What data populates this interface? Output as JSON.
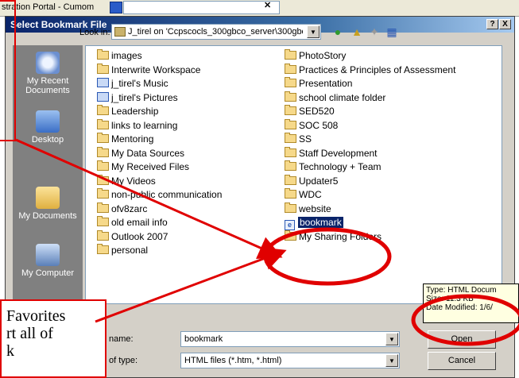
{
  "background_window": {
    "title_fragment": "stration Portal - Cumom"
  },
  "dialog": {
    "title": "Select Bookmark File",
    "help_button": "?",
    "close_button": "X",
    "look_in_label": "Look in:",
    "look_in_value": "J_tirel on 'Ccpscocls_300gbco_server\\300gbc",
    "places": [
      "My Recent Documents",
      "Desktop",
      "My Documents",
      "My Computer"
    ],
    "files_left": [
      {
        "name": "images",
        "type": "folder"
      },
      {
        "name": "Interwrite Workspace",
        "type": "folder"
      },
      {
        "name": "j_tirel's Music",
        "type": "folder-special"
      },
      {
        "name": "j_tirel's Pictures",
        "type": "folder-special"
      },
      {
        "name": "Leadership",
        "type": "folder"
      },
      {
        "name": "links to learning",
        "type": "folder"
      },
      {
        "name": "Mentoring",
        "type": "folder"
      },
      {
        "name": "My Data Sources",
        "type": "folder"
      },
      {
        "name": "My Received Files",
        "type": "folder"
      },
      {
        "name": "My Videos",
        "type": "folder"
      },
      {
        "name": "non-public communication",
        "type": "folder"
      },
      {
        "name": "ofv8zarc",
        "type": "folder"
      },
      {
        "name": "old email info",
        "type": "folder"
      },
      {
        "name": "Outlook 2007",
        "type": "folder"
      },
      {
        "name": "personal",
        "type": "folder"
      }
    ],
    "files_right": [
      {
        "name": "PhotoStory",
        "type": "folder"
      },
      {
        "name": "Practices & Principles of Assessment",
        "type": "folder"
      },
      {
        "name": "Presentation",
        "type": "folder"
      },
      {
        "name": "school climate folder",
        "type": "folder"
      },
      {
        "name": "SED520",
        "type": "folder"
      },
      {
        "name": "SOC 508",
        "type": "folder"
      },
      {
        "name": "SS",
        "type": "folder"
      },
      {
        "name": "Staff Development",
        "type": "folder"
      },
      {
        "name": "Technology + Team",
        "type": "folder"
      },
      {
        "name": "Updater5",
        "type": "folder"
      },
      {
        "name": "WDC",
        "type": "folder"
      },
      {
        "name": "website",
        "type": "folder"
      },
      {
        "name": "bookmark",
        "type": "htm",
        "selected": true
      },
      {
        "name": "My Sharing Folders",
        "type": "link"
      }
    ],
    "file_name_label": "name:",
    "file_name_value": "bookmark",
    "file_type_label": "of type:",
    "file_type_value": "HTML files (*.htm, *.html)",
    "open_button": "Open",
    "cancel_button": "Cancel"
  },
  "tooltip": {
    "line1": "Type: HTML Docum",
    "line2": "Size: 11.3 KB",
    "line3": "Date Modified: 1/6/"
  },
  "annotation": {
    "line1": "Favorites",
    "line2": "rt all of",
    "line3": "k"
  },
  "colors": {
    "annotation_red": "#e00000",
    "selection": "#0a246a",
    "places_bg": "#808080"
  }
}
